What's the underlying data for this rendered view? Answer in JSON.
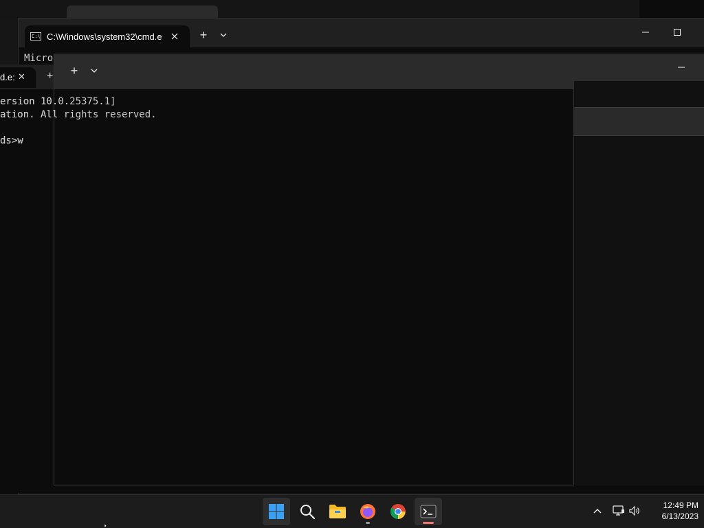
{
  "background_window": {
    "tab_title": "",
    "close_icon": "close-icon"
  },
  "main_window": {
    "tab_title": "C:\\Windows\\system32\\cmd.e:",
    "new_tab_label": "+",
    "dropdown_label": "⌄",
    "minimize_label": "—",
    "maximize_label": "☐",
    "terminal_visible_text": "Micro"
  },
  "left_window": {
    "tab_title": "d.e:",
    "close_label": "✕",
    "new_tab_label": "+",
    "terminal_lines": [
      "ersion 10.0.25375.1]",
      "ation. All rights reserved.",
      "",
      "ds>w"
    ]
  },
  "front_window": {
    "new_tab_label": "+",
    "dropdown_label": "⌄",
    "minimize_label": "—"
  },
  "taskbar": {
    "apps": [
      {
        "name": "start",
        "icon": "windows-icon"
      },
      {
        "name": "search",
        "icon": "search-icon"
      },
      {
        "name": "file-explorer",
        "icon": "folder-icon"
      },
      {
        "name": "firefox",
        "icon": "firefox-icon"
      },
      {
        "name": "chrome",
        "icon": "chrome-icon"
      },
      {
        "name": "terminal",
        "icon": "terminal-icon"
      }
    ],
    "tray": {
      "chevron_label": "^",
      "time": "12:49 PM",
      "date": "6/13/2023"
    }
  },
  "colors": {
    "terminal_bg": "#0c0c0c",
    "titlebar": "#202020",
    "taskbar": "#1c1c1c",
    "accent_windows": "#3aa0f3",
    "indicator_terminal": "#f0786e"
  }
}
